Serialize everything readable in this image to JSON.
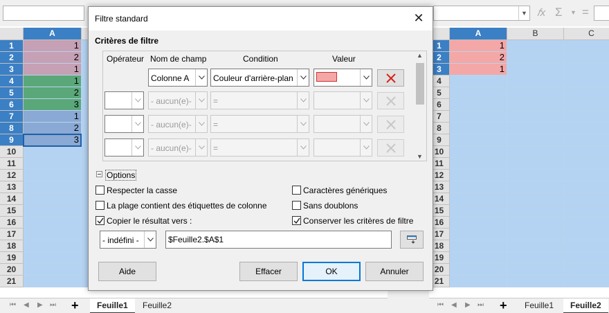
{
  "left_window": {
    "formula_icons": {
      "fx": "𝑓x",
      "sum": "Σ",
      "eq": "="
    },
    "columns": [
      "A"
    ],
    "rows": [
      "1",
      "2",
      "3",
      "4",
      "5",
      "6",
      "7",
      "8",
      "9",
      "10",
      "11",
      "12",
      "13",
      "14",
      "15",
      "16",
      "17",
      "18",
      "19",
      "20",
      "21"
    ],
    "values": [
      "1",
      "2",
      "1",
      "1",
      "2",
      "3",
      "1",
      "2",
      "3"
    ],
    "cell_colors": [
      "#c6a0b4",
      "#c6a0b4",
      "#c6a0b4",
      "#5aa87a",
      "#5aa87a",
      "#5aa87a",
      "#8aa9d4",
      "#8aa9d4",
      "#8aa9d4"
    ],
    "tabs": [
      "Feuille1",
      "Feuille2"
    ],
    "active_tab": "Feuille1"
  },
  "right_window": {
    "formula_icons": {
      "fx": "𝑓x",
      "sum": "Σ",
      "eq": "="
    },
    "columns": [
      "A",
      "B",
      "C"
    ],
    "rows": [
      "1",
      "2",
      "3",
      "4",
      "5",
      "6",
      "7",
      "8",
      "9",
      "10",
      "11",
      "12",
      "13",
      "14",
      "15",
      "16",
      "17",
      "18",
      "19",
      "20",
      "21"
    ],
    "values": [
      "1",
      "2",
      "1"
    ],
    "cell_color": "#f4a7a7",
    "tabs": [
      "Feuille1",
      "Feuille2"
    ],
    "active_tab": "Feuille2"
  },
  "dialog": {
    "title": "Filtre standard",
    "section_title": "Critères de filtre",
    "headers": {
      "operator": "Opérateur",
      "field": "Nom de champ",
      "condition": "Condition",
      "value": "Valeur"
    },
    "rows": [
      {
        "operator": "",
        "field": "Colonne A",
        "condition": "Couleur d'arrière-plan",
        "value_swatch": "#f4a7a7",
        "enabled": true
      },
      {
        "operator": "",
        "field": "- aucun(e)-",
        "condition": "=",
        "value_swatch": "",
        "enabled": false
      },
      {
        "operator": "",
        "field": "- aucun(e)-",
        "condition": "=",
        "value_swatch": "",
        "enabled": false
      },
      {
        "operator": "",
        "field": "- aucun(e)-",
        "condition": "=",
        "value_swatch": "",
        "enabled": false
      }
    ],
    "options_label": "Options",
    "options": {
      "case_sensitive": {
        "label": "Respecter la casse",
        "checked": false
      },
      "range_has_headers": {
        "label": "La plage contient des étiquettes de colonne",
        "checked": false
      },
      "copy_results": {
        "label": "Copier le résultat vers :",
        "checked": true
      },
      "wildcards": {
        "label": "Caractères génériques",
        "checked": false
      },
      "no_duplicates": {
        "label": "Sans doublons",
        "checked": false
      },
      "keep_criteria": {
        "label": "Conserver les critères de filtre",
        "checked": true
      }
    },
    "copy_target_select": "- indéfini -",
    "copy_target_value": "$Feuille2.$A$1",
    "buttons": {
      "help": "Aide",
      "reset": "Effacer",
      "ok": "OK",
      "cancel": "Annuler"
    },
    "delete_icon_color": "#d9231d"
  }
}
